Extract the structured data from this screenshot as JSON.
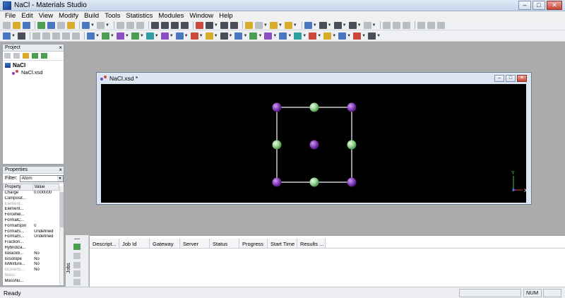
{
  "window": {
    "title": "NaCl - Materials Studio",
    "title_ghost": "",
    "minimize": "–",
    "maximize": "□",
    "close": "✕"
  },
  "menu": [
    "File",
    "Edit",
    "View",
    "Modify",
    "Build",
    "Tools",
    "Statistics",
    "Modules",
    "Window",
    "Help"
  ],
  "project": {
    "title": "Project",
    "close": "×",
    "root": "NaCl",
    "child": "NaCl.xsd"
  },
  "properties": {
    "title": "Properties",
    "close": "×",
    "filter_label": "Filter:",
    "filter_value": "Atom",
    "columns": [
      "Property",
      "Value"
    ],
    "rows": [
      {
        "name": "Charge",
        "value": "0.000000",
        "dim": false
      },
      {
        "name": "Composit...",
        "value": "",
        "dim": false
      },
      {
        "name": "Element...",
        "value": "",
        "dim": true
      },
      {
        "name": "Element...",
        "value": "",
        "dim": false
      },
      {
        "name": "Forcefiel...",
        "value": "",
        "dim": false
      },
      {
        "name": "FormalC...",
        "value": "",
        "dim": false
      },
      {
        "name": "FormalSpin",
        "value": "0",
        "dim": false
      },
      {
        "name": "FormalS...",
        "value": "Undefined",
        "dim": false
      },
      {
        "name": "FormalS...",
        "value": "Undefined",
        "dim": false
      },
      {
        "name": "Fraction...",
        "value": "",
        "dim": false
      },
      {
        "name": "Hybridiza...",
        "value": "",
        "dim": false
      },
      {
        "name": "IsBackb...",
        "value": "No",
        "dim": false
      },
      {
        "name": "IsIsotope",
        "value": "No",
        "dim": false
      },
      {
        "name": "IsMixture...",
        "value": "No",
        "dim": false
      },
      {
        "name": "IsOverrp...",
        "value": "No",
        "dim": true
      },
      {
        "name": "Mass",
        "value": "",
        "dim": true
      },
      {
        "name": "MassNu...",
        "value": "",
        "dim": false
      }
    ]
  },
  "document": {
    "title": "NaCl.xsd *",
    "axes": {
      "x": "X",
      "y": "Y"
    }
  },
  "jobs": {
    "side_label": "Jobs",
    "columns": [
      "Descript...",
      "Job Id",
      "Gateway",
      "Server",
      "Status",
      "Progress",
      "Start Time",
      "Results ..."
    ]
  },
  "status": {
    "ready": "Ready",
    "num": "NUM"
  },
  "colors": {
    "na_atom": "#8a3fbf",
    "cl_atom": "#8fd18b",
    "viewport_bg": "#000000",
    "bond": "#cfcfcf"
  }
}
